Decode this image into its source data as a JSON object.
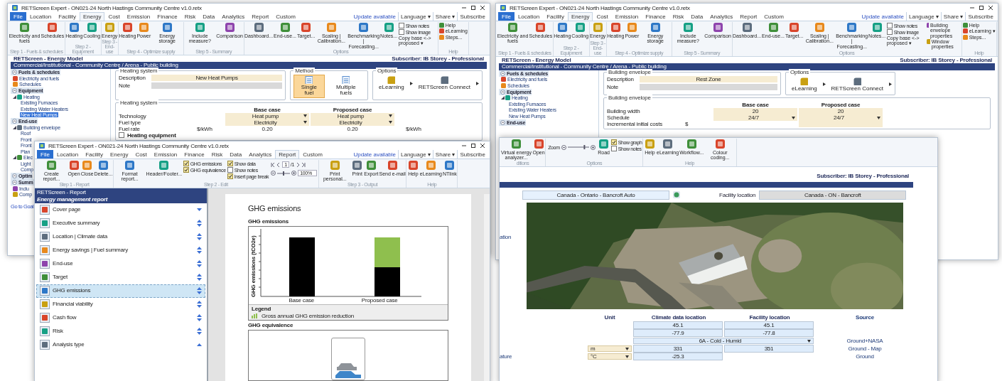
{
  "windows": [
    {
      "kind": "model",
      "title": "RETScreen Expert - ON021-24 North Hastings Community Centre v1.0.retx",
      "tabs": [
        {
          "label": "File",
          "selected": false
        },
        {
          "label": "Location",
          "selected": false
        },
        {
          "label": "Facility",
          "selected": false
        },
        {
          "label": "Energy",
          "selected": true
        },
        {
          "label": "Cost",
          "selected": false
        },
        {
          "label": "Emission",
          "selected": false
        },
        {
          "label": "Finance",
          "selected": false
        },
        {
          "label": "Risk",
          "selected": false
        },
        {
          "label": "Data",
          "selected": false
        },
        {
          "label": "Analytics",
          "selected": false
        },
        {
          "label": "Report",
          "selected": false
        },
        {
          "label": "Custom",
          "selected": false
        }
      ],
      "tab_extras": [
        "Update available",
        "Language ▾",
        "Share ▾",
        "Subscribe"
      ],
      "ribbon": [
        {
          "label": "Step 1 - Fuels & schedules",
          "items": [
            {
              "kind": "button",
              "label": "Electricity and fuels"
            },
            {
              "kind": "button",
              "label": "Schedules"
            }
          ]
        },
        {
          "label": "Step 2 - Equipment",
          "items": [
            {
              "kind": "button",
              "label": "Heating"
            },
            {
              "kind": "button",
              "label": "Cooling"
            }
          ]
        },
        {
          "label": "Step 3 - End-use",
          "items": [
            {
              "kind": "button",
              "label": "Energy"
            }
          ]
        },
        {
          "label": "Step 4 - Optimize supply",
          "items": [
            {
              "kind": "button",
              "label": "Heating"
            },
            {
              "kind": "button",
              "label": "Power"
            },
            {
              "kind": "button",
              "label": "Energy storage"
            }
          ]
        },
        {
          "label": "Step 5 - Summary",
          "items": [
            {
              "kind": "button",
              "label": "Include measure?"
            },
            {
              "kind": "button",
              "label": "Comparison"
            }
          ]
        },
        {
          "label": "Options",
          "items": [
            {
              "kind": "button",
              "label": "Dashboard..."
            },
            {
              "kind": "button",
              "label": "End-use..."
            },
            {
              "kind": "button",
              "label": "Target..."
            },
            {
              "kind": "button",
              "label": "Scaling | Calibration..."
            },
            {
              "kind": "button",
              "label": "Benchmarking | Forecasting..."
            },
            {
              "kind": "button",
              "label": "Notes..."
            },
            {
              "kind": "checks",
              "items": [
                {
                  "label": "Show notes",
                  "checked": false
                },
                {
                  "label": "Show image",
                  "checked": false
                }
              ],
              "link": "Copy base <-> proposed ▾"
            }
          ]
        },
        {
          "label": "Help",
          "items": [
            {
              "kind": "menu",
              "items": [
                "Help",
                "eLearning",
                "Steps..."
              ]
            }
          ]
        }
      ],
      "header": "RETScreen - Energy Model",
      "subscriber": "Subscriber: IB Storey - Professional",
      "breadcrumb": "Commercial/Institutional - Community Centre / Arena - Public building",
      "nav": [
        {
          "title": "Fuels & schedules",
          "items": [
            {
              "label": "Electricity and fuels",
              "selected": false
            },
            {
              "label": "Schedules",
              "selected": false
            }
          ]
        },
        {
          "title": "Equipment",
          "items": [
            {
              "label": "Heating",
              "selected": false,
              "children": [
                {
                  "label": "Existing Furnaces",
                  "selected": false
                },
                {
                  "label": "Existing Water Heaters",
                  "selected": false
                },
                {
                  "label": "New Heat Pumps",
                  "selected": true
                }
              ]
            }
          ]
        },
        {
          "title": "End-use",
          "items": [
            {
              "label": "Building envelope",
              "selected": false,
              "children": [
                {
                  "label": "Roof",
                  "selected": false
                },
                {
                  "label": "Front",
                  "selected": false
                },
                {
                  "label": "Front",
                  "selected": false
                },
                {
                  "label": "Plan",
                  "selected": false
                }
              ]
            },
            {
              "label": "Elec",
              "selected": false,
              "children": [
                {
                  "label": "Light",
                  "selected": false
                },
                {
                  "label": "Comp",
                  "selected": false
                }
              ]
            }
          ]
        },
        {
          "title": "Optim"
        },
        {
          "title": "Summ",
          "items": [
            {
              "label": "Inclu",
              "selected": false
            },
            {
              "label": "Comp",
              "selected": false
            }
          ]
        }
      ],
      "nav_link": "Go to Goal",
      "form": {
        "panel_title": "Heating system",
        "description_label": "Description",
        "description": "New Heat Pumps",
        "note_label": "Note",
        "method": {
          "title": "Method",
          "options": [
            {
              "label": "Single fuel",
              "selected": true
            },
            {
              "label": "Multiple fuels",
              "selected": false
            }
          ]
        },
        "options": {
          "title": "Options",
          "items": [
            "eLearning",
            "RETScreen Connect"
          ]
        },
        "table": {
          "title": "Heating system",
          "headers": [
            "Base case",
            "Proposed case"
          ],
          "rows": [
            {
              "kind": "select",
              "label": "Technology",
              "base": "Heat pump",
              "proposed": "Heat pump"
            },
            {
              "kind": "select",
              "label": "Fuel type",
              "base": "Electricity",
              "proposed": "Electricity"
            },
            {
              "kind": "value",
              "label": "Fuel rate",
              "unit": "$/kWh",
              "base": "0.20",
              "proposed": "0.20",
              "unit_right": "$/kWh"
            }
          ],
          "footer_check": {
            "label": "Heating equipment",
            "checked": false
          }
        }
      }
    },
    {
      "kind": "model",
      "title": "RETScreen Expert - ON021-24 North Hastings Community Centre v1.0.retx",
      "tabs": [
        {
          "label": "File",
          "selected": false
        },
        {
          "label": "Location",
          "selected": false
        },
        {
          "label": "Facility",
          "selected": false
        },
        {
          "label": "Energy",
          "selected": true
        },
        {
          "label": "Cost",
          "selected": false
        },
        {
          "label": "Emission",
          "selected": false
        },
        {
          "label": "Finance",
          "selected": false
        },
        {
          "label": "Risk",
          "selected": false
        },
        {
          "label": "Data",
          "selected": false
        },
        {
          "label": "Analytics",
          "selected": false
        },
        {
          "label": "Report",
          "selected": false
        },
        {
          "label": "Custom",
          "selected": false
        }
      ],
      "tab_extras": [
        "Update available",
        "Language ▾",
        "Share ▾",
        "Subscribe"
      ],
      "ribbon": [
        {
          "label": "Step 1 - Fuels & schedules",
          "items": [
            {
              "kind": "button",
              "label": "Electricity and fuels"
            },
            {
              "kind": "button",
              "label": "Schedules"
            }
          ]
        },
        {
          "label": "Step 2 - Equipment",
          "items": [
            {
              "kind": "button",
              "label": "Heating"
            },
            {
              "kind": "button",
              "label": "Cooling"
            }
          ]
        },
        {
          "label": "Step 3 - End-use",
          "items": [
            {
              "kind": "button",
              "label": "Energy"
            }
          ]
        },
        {
          "label": "Step 4 - Optimize supply",
          "items": [
            {
              "kind": "button",
              "label": "Heating"
            },
            {
              "kind": "button",
              "label": "Power"
            },
            {
              "kind": "button",
              "label": "Energy storage"
            }
          ]
        },
        {
          "label": "Step 5 - Summary",
          "items": [
            {
              "kind": "button",
              "label": "Include measure?"
            },
            {
              "kind": "button",
              "label": "Comparison"
            }
          ]
        },
        {
          "label": "Options",
          "items": [
            {
              "kind": "button",
              "label": "Dashboard..."
            },
            {
              "kind": "button",
              "label": "End-use..."
            },
            {
              "kind": "button",
              "label": "Target..."
            },
            {
              "kind": "button",
              "label": "Scaling | Calibration..."
            },
            {
              "kind": "button",
              "label": "Benchmarking | Forecasting..."
            },
            {
              "kind": "button",
              "label": "Notes..."
            },
            {
              "kind": "checks",
              "items": [
                {
                  "label": "Show notes",
                  "checked": false
                },
                {
                  "label": "Show image",
                  "checked": false
                }
              ],
              "link": "Copy base <-> proposed ▾"
            },
            {
              "kind": "menu",
              "items": [
                "Building envelope properties",
                "Window properties"
              ]
            }
          ]
        },
        {
          "label": "Help",
          "items": [
            {
              "kind": "menu",
              "items": [
                "Help",
                "eLearning ▾",
                "Steps..."
              ]
            }
          ]
        }
      ],
      "header": "RETScreen - Energy Model",
      "subscriber": "Subscriber: IB Storey - Professional",
      "breadcrumb": "Commercial/Institutional - Community Centre / Arena - Public building",
      "nav": [
        {
          "title": "Fuels & schedules",
          "items": [
            {
              "label": "Electricity and fuels",
              "selected": false
            },
            {
              "label": "Schedules",
              "selected": false
            }
          ]
        },
        {
          "title": "Equipment",
          "items": [
            {
              "label": "Heating",
              "selected": false,
              "children": [
                {
                  "label": "Existing Furnaces",
                  "selected": false
                },
                {
                  "label": "Existing Water Heaters",
                  "selected": false
                },
                {
                  "label": "New Heat Pumps",
                  "selected": false
                }
              ]
            }
          ]
        },
        {
          "title": "End-use"
        }
      ],
      "form": {
        "panel_title": "Building envelope",
        "description_label": "Description",
        "description": "Rest Zone",
        "note_label": "Note",
        "options": {
          "title": "Options",
          "items": [
            "eLearning",
            "RETScreen Connect"
          ]
        },
        "table": {
          "title": "Building envelope",
          "headers": [
            "Base case",
            "Proposed case"
          ],
          "rows": [
            {
              "kind": "field",
              "label": "Building width",
              "base": "20",
              "proposed": "20"
            },
            {
              "kind": "select",
              "label": "Schedule",
              "base": "24/7",
              "proposed": "24/7"
            },
            {
              "kind": "cost",
              "label": "Incremental initial costs",
              "unit": "$"
            }
          ]
        }
      }
    },
    {
      "kind": "report",
      "title": "RETScreen Expert - ON021-24 North Hastings Community Centre v1.0.retx",
      "tabs": [
        {
          "label": "File",
          "selected": false
        },
        {
          "label": "Location",
          "selected": false
        },
        {
          "label": "Facility",
          "selected": false
        },
        {
          "label": "Energy",
          "selected": false
        },
        {
          "label": "Cost",
          "selected": false
        },
        {
          "label": "Emission",
          "selected": false
        },
        {
          "label": "Finance",
          "selected": false
        },
        {
          "label": "Risk",
          "selected": false
        },
        {
          "label": "Data",
          "selected": false
        },
        {
          "label": "Analytics",
          "selected": false
        },
        {
          "label": "Report",
          "selected": true
        },
        {
          "label": "Custom",
          "selected": false
        }
      ],
      "tab_extras": [
        "Update available",
        "Language ▾",
        "Share ▾",
        "Subscribe"
      ],
      "ribbon": [
        {
          "label": "Step 1 - Report",
          "items": [
            {
              "kind": "button",
              "label": "Create report..."
            },
            {
              "kind": "button",
              "label": "Open"
            },
            {
              "kind": "button",
              "label": "Close"
            },
            {
              "kind": "button",
              "label": "Delete..."
            }
          ]
        },
        {
          "label": "Step 2 - Edit",
          "items": [
            {
              "kind": "button",
              "label": "Format report..."
            },
            {
              "kind": "button",
              "label": "Header/Footer..."
            },
            {
              "kind": "checks",
              "items": [
                {
                  "label": "GHG emissions",
                  "checked": true
                },
                {
                  "label": "GHG equivalence",
                  "checked": true
                }
              ]
            },
            {
              "kind": "checks",
              "items": [
                {
                  "label": "Show data",
                  "checked": true
                },
                {
                  "label": "Show notes",
                  "checked": false
                },
                {
                  "label": "Insert page break",
                  "checked": true
                }
              ]
            },
            {
              "kind": "pager",
              "page": "1",
              "total": "/1",
              "zoom": "100%",
              "level": 0.5
            }
          ]
        },
        {
          "label": "Step 3 - Output",
          "items": [
            {
              "kind": "button",
              "label": "Print personal..."
            },
            {
              "kind": "button",
              "label": "Print"
            },
            {
              "kind": "button",
              "label": "Export"
            },
            {
              "kind": "button",
              "label": "Send e-mail"
            }
          ]
        },
        {
          "label": "Help",
          "items": [
            {
              "kind": "button",
              "label": "Help"
            },
            {
              "kind": "button",
              "label": "eLearning"
            },
            {
              "kind": "button",
              "label": "NTlink"
            }
          ]
        }
      ],
      "panel_title": "RETScreen - Report",
      "report_name": "Energy management report",
      "sections": [
        {
          "label": "Cover page",
          "selected": false
        },
        {
          "label": "Executive summary",
          "selected": false
        },
        {
          "label": "Location | Climate data",
          "selected": false
        },
        {
          "label": "Energy savings | Fuel summary",
          "selected": false
        },
        {
          "label": "End-use",
          "selected": false
        },
        {
          "label": "Target",
          "selected": false
        },
        {
          "label": "GHG emissions",
          "selected": true
        },
        {
          "label": "Financial viability",
          "selected": false
        },
        {
          "label": "Cash flow",
          "selected": false
        },
        {
          "label": "Risk",
          "selected": false
        },
        {
          "label": "Analysis type",
          "selected": false
        }
      ],
      "page": {
        "heading": "GHG emissions",
        "chart_title": "GHG emissions",
        "chart": {
          "ylabel": "GHG emissions (tCO2e)",
          "categories": [
            "Base case",
            "Proposed case"
          ],
          "legend_title": "Legend",
          "legend": "Gross annual GHG emission reduction"
        },
        "equivalence_title": "GHG equivalence"
      }
    },
    {
      "kind": "map",
      "ribbon": [
        {
          "label": "ditions",
          "items": [
            {
              "kind": "button",
              "label": "Virtual energy analyzer..."
            },
            {
              "kind": "button",
              "label": "Open"
            }
          ]
        },
        {
          "label": "Options",
          "items": [
            {
              "kind": "zoom",
              "label": "Zoom",
              "level": 0.8
            },
            {
              "kind": "button",
              "label": "Road"
            },
            {
              "kind": "checks",
              "items": [
                {
                  "label": "Show graph",
                  "checked": true
                },
                {
                  "label": "Show notes",
                  "checked": false
                }
              ]
            }
          ]
        },
        {
          "label": "Help",
          "items": [
            {
              "kind": "button",
              "label": "Help"
            },
            {
              "kind": "button",
              "label": "eLearning"
            },
            {
              "kind": "button",
              "label": "Workflow..."
            },
            {
              "kind": "button",
              "label": "Colour coding..."
            }
          ]
        }
      ],
      "subscriber": "Subscriber: IB Storey - Professional",
      "climate_location": "Canada - Ontario - Bancroft Auto",
      "facility_label": "Facility location",
      "facility_location": "Canada - ON - Bancroft",
      "side_label": "ation",
      "table": {
        "headers": [
          "Unit",
          "Climate data location",
          "Facility location",
          "Source"
        ],
        "rows": [
          {
            "kind": "pair",
            "climate": "45.1",
            "facility": "45.1"
          },
          {
            "kind": "pair",
            "climate": "-77.9",
            "facility": "-77.8"
          },
          {
            "kind": "merged",
            "climate": "6A - Cold - Humid",
            "source": "Ground+NASA"
          },
          {
            "kind": "pair",
            "unit": "m",
            "climate": "331",
            "facility": "351",
            "source": "Ground - Map"
          },
          {
            "kind": "pair",
            "label": "ature",
            "unit": "°C",
            "climate": "-25.3",
            "source": "Ground"
          }
        ]
      }
    }
  ]
}
